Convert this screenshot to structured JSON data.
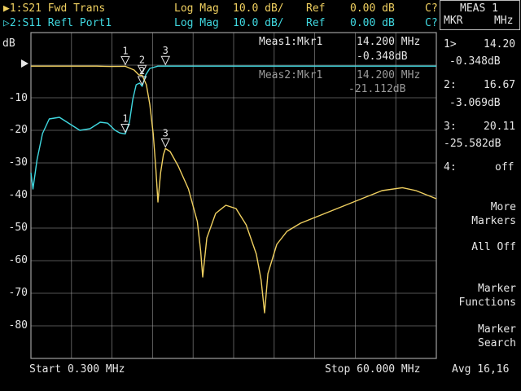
{
  "header": {
    "trace1": {
      "label": "▶1:S21 Fwd Trans",
      "format": "Log Mag",
      "scale": "10.0 dB/",
      "ref_label": "Ref",
      "ref_value": "0.00 dB",
      "flag": "C?"
    },
    "trace2": {
      "label": "▷2:S11 Refl Port1",
      "format": "Log Mag",
      "scale": "10.0 dB/",
      "ref_label": "Ref",
      "ref_value": "0.00 dB",
      "flag": "C?"
    }
  },
  "unit_label": "dB",
  "y_ticks": [
    "-10",
    "-20",
    "-30",
    "-40",
    "-50",
    "-60",
    "-70",
    "-80"
  ],
  "plot_annotations": {
    "meas1_label": "Meas1:Mkr1",
    "meas1_freq": "14.200 MHz",
    "meas1_value": "-0.348dB",
    "meas2_label": "Meas2:Mkr1",
    "meas2_freq": "14.200 MHz",
    "meas2_value": "-21.112dB"
  },
  "footer": {
    "start": "Start 0.300 MHz",
    "stop": "Stop 60.000 MHz",
    "avg": "Avg 16,16"
  },
  "right_panel": {
    "title": "MEAS 1",
    "sub_left": "MKR",
    "sub_right": "MHz",
    "markers": [
      {
        "id": "1>",
        "freq": "14.20",
        "value": "-0.348dB"
      },
      {
        "id": "2:",
        "freq": "16.67",
        "value": "-3.069dB"
      },
      {
        "id": "3:",
        "freq": "20.11",
        "value": "-25.582dB"
      },
      {
        "id": "4:",
        "freq": "off"
      }
    ],
    "softkeys": {
      "more_markers": [
        "More",
        "Markers"
      ],
      "all_off": "All Off",
      "marker_functions": [
        "Marker",
        "Functions"
      ],
      "marker_search": [
        "Marker",
        "Search"
      ]
    }
  },
  "marker_labels": [
    "1",
    "2",
    "3",
    "1",
    "2",
    "3"
  ],
  "colors": {
    "trace1": "#f0d060",
    "trace2": "#40d8e0",
    "grid": "#a0a0a0",
    "background": "#000000"
  },
  "chart_data": {
    "type": "line",
    "x_range_mhz": [
      0.3,
      60.0
    ],
    "ylim": [
      -90,
      10
    ],
    "y_unit": "dB",
    "grid": true,
    "series": [
      {
        "name": "S21 Fwd Trans",
        "points": [
          [
            0.3,
            -0.3
          ],
          [
            5,
            -0.3
          ],
          [
            10,
            -0.3
          ],
          [
            12,
            -0.4
          ],
          [
            14.2,
            -0.35
          ],
          [
            15.5,
            -1.5
          ],
          [
            16.2,
            -3
          ],
          [
            16.67,
            -3.1
          ],
          [
            17.3,
            -6
          ],
          [
            17.8,
            -12
          ],
          [
            18.3,
            -21
          ],
          [
            18.7,
            -32
          ],
          [
            19.0,
            -42
          ],
          [
            19.4,
            -33
          ],
          [
            19.8,
            -27.5
          ],
          [
            20.11,
            -25.6
          ],
          [
            20.8,
            -26.5
          ],
          [
            22,
            -31
          ],
          [
            23.5,
            -38
          ],
          [
            24.8,
            -48
          ],
          [
            25.3,
            -57
          ],
          [
            25.6,
            -65
          ],
          [
            26.2,
            -53
          ],
          [
            27.5,
            -45.5
          ],
          [
            29,
            -43
          ],
          [
            30.5,
            -44
          ],
          [
            32,
            -49
          ],
          [
            33.5,
            -58
          ],
          [
            34.2,
            -66
          ],
          [
            34.7,
            -76
          ],
          [
            35.2,
            -64
          ],
          [
            36.5,
            -55
          ],
          [
            38,
            -51
          ],
          [
            40,
            -48.5
          ],
          [
            43,
            -46
          ],
          [
            46,
            -43.5
          ],
          [
            49,
            -41
          ],
          [
            52,
            -38.5
          ],
          [
            55,
            -37.6
          ],
          [
            57,
            -38.5
          ],
          [
            60,
            -41
          ]
        ]
      },
      {
        "name": "S11 Refl Port1",
        "points": [
          [
            0.3,
            -33
          ],
          [
            0.6,
            -38
          ],
          [
            1.2,
            -29
          ],
          [
            2,
            -21
          ],
          [
            3,
            -16.5
          ],
          [
            4.5,
            -16
          ],
          [
            6,
            -18
          ],
          [
            7.5,
            -20
          ],
          [
            9,
            -19.5
          ],
          [
            10.5,
            -17.5
          ],
          [
            11.6,
            -17.8
          ],
          [
            12.7,
            -20
          ],
          [
            13.4,
            -20.8
          ],
          [
            14.2,
            -21.1
          ],
          [
            14.8,
            -17.5
          ],
          [
            15.3,
            -10.5
          ],
          [
            15.8,
            -6
          ],
          [
            16.3,
            -5.5
          ],
          [
            16.67,
            -6.5
          ],
          [
            17.2,
            -3
          ],
          [
            17.8,
            -1
          ],
          [
            19,
            -0.3
          ],
          [
            22,
            -0.3
          ],
          [
            40,
            -0.3
          ],
          [
            60,
            -0.3
          ]
        ]
      }
    ],
    "markers": [
      {
        "trace": "S21 Fwd Trans",
        "id": "1",
        "x": 14.2,
        "y": -0.348
      },
      {
        "trace": "S21 Fwd Trans",
        "id": "2",
        "x": 16.67,
        "y": -3.069
      },
      {
        "trace": "S21 Fwd Trans",
        "id": "3",
        "x": 20.11,
        "y": -25.582
      },
      {
        "trace": "S11 Refl Port1",
        "id": "1",
        "x": 14.2,
        "y": -21.112
      },
      {
        "trace": "S11 Refl Port1",
        "id": "2",
        "x": 16.67,
        "y": -6.5
      },
      {
        "trace": "S11 Refl Port1",
        "id": "3",
        "x": 20.11,
        "y": -0.3
      }
    ]
  }
}
